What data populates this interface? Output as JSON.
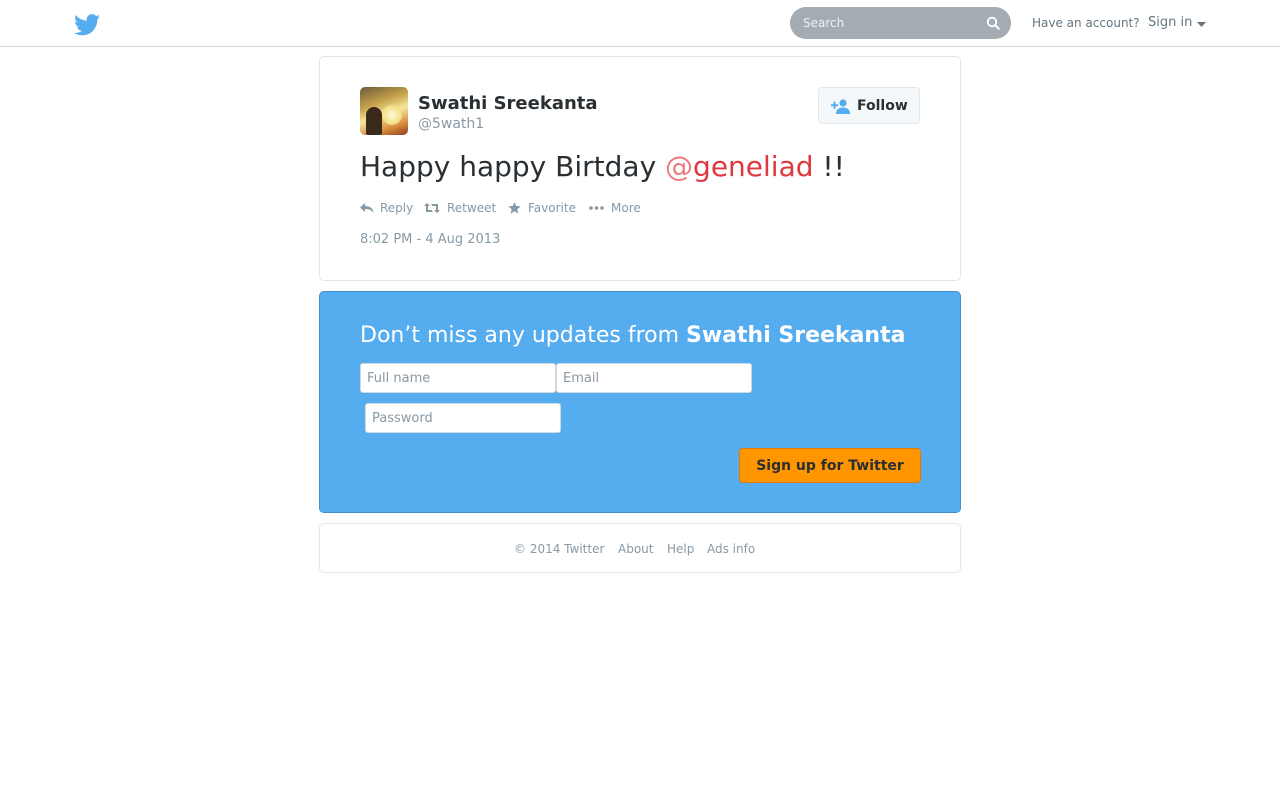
{
  "header": {
    "logo_icon": "twitter-bird-icon",
    "search_placeholder": "Search",
    "search_icon": "search-icon",
    "have_account": "Have an account?",
    "sign_in": "Sign in",
    "brand_color": "#55acee"
  },
  "tweet": {
    "author_name": "Swathi Sreekanta",
    "author_handle": "@5wath1",
    "follow_label": "Follow",
    "text_before": "Happy happy Birtday ",
    "mention_at": "@",
    "mention_name": "geneliad",
    "text_after": " !!",
    "actions": [
      {
        "label": "Reply",
        "icon": "reply-icon"
      },
      {
        "label": "Retweet",
        "icon": "retweet-icon"
      },
      {
        "label": "Favorite",
        "icon": "star-icon"
      },
      {
        "label": "More",
        "icon": "more-dots-icon"
      }
    ],
    "timestamp": "8:02 PM - 4 Aug 2013",
    "mention_color": "#e0383e"
  },
  "signup": {
    "title_prefix": "Don’t miss any updates from ",
    "title_name": "Swathi Sreekanta",
    "full_name_placeholder": "Full name",
    "email_placeholder": "Email",
    "password_placeholder": "Password",
    "button_label": "Sign up for Twitter",
    "button_color": "#ff9600"
  },
  "footer": {
    "copyright": "© 2014 Twitter",
    "links": [
      "About",
      "Help",
      "Ads info"
    ]
  }
}
